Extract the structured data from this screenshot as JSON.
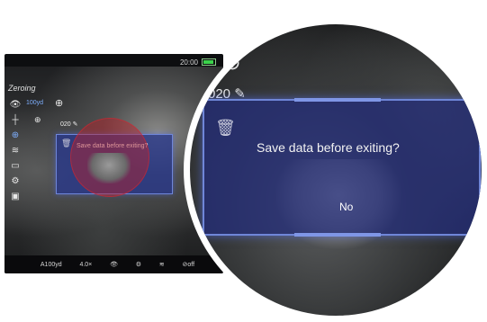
{
  "status": {
    "time": "20:00"
  },
  "menu": {
    "title": "Zeroing",
    "distance": "100yd",
    "zero_value": "020"
  },
  "dialog": {
    "message": "Save data before exiting?",
    "no_label": "No"
  },
  "bottom_bar": {
    "distance": "A100yd",
    "zoom": "4.0×",
    "rec": "off"
  },
  "icons": [
    "eye-icon",
    "cross-icon",
    "crosshair-icon",
    "wifi-icon",
    "screen-icon",
    "gear-icon",
    "image-icon",
    "trash-icon",
    "pencil-icon"
  ],
  "colors": {
    "accent": "#7fb0ff",
    "dialog": "#2d3a8f",
    "battery": "#3bd34b",
    "highlight": "#be1e28"
  }
}
